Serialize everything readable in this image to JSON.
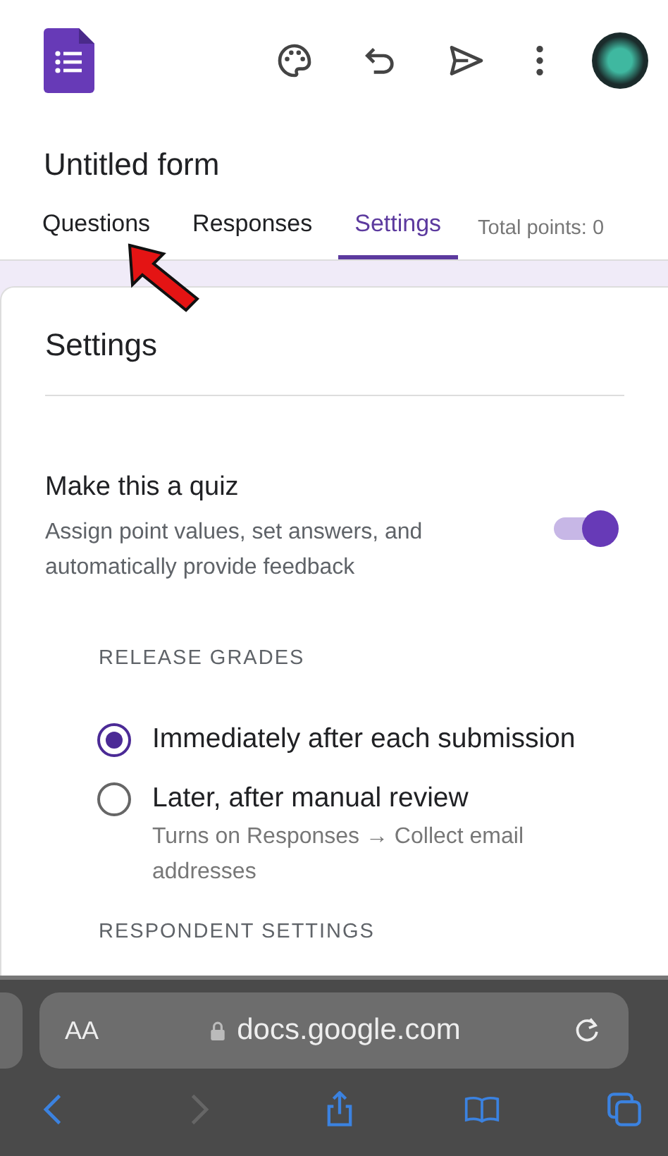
{
  "header": {
    "title": "Untitled form"
  },
  "tabs": [
    {
      "label": "Questions",
      "selected": false
    },
    {
      "label": "Responses",
      "selected": false
    },
    {
      "label": "Settings",
      "selected": true
    }
  ],
  "total_points": "Total points: 0",
  "settings": {
    "title": "Settings",
    "quiz": {
      "label": "Make this a quiz",
      "description": "Assign point values, set answers, and automatically provide feedback",
      "on": true
    },
    "release_grades": {
      "heading": "RELEASE GRADES",
      "options": [
        {
          "label": "Immediately after each submission",
          "selected": true
        },
        {
          "label": "Later, after manual review",
          "note": "Turns on Responses → Collect email addresses",
          "selected": false
        }
      ]
    },
    "next_heading": "RESPONDENT SETTINGS"
  },
  "browser": {
    "text_size": "AA",
    "url": "docs.google.com"
  }
}
